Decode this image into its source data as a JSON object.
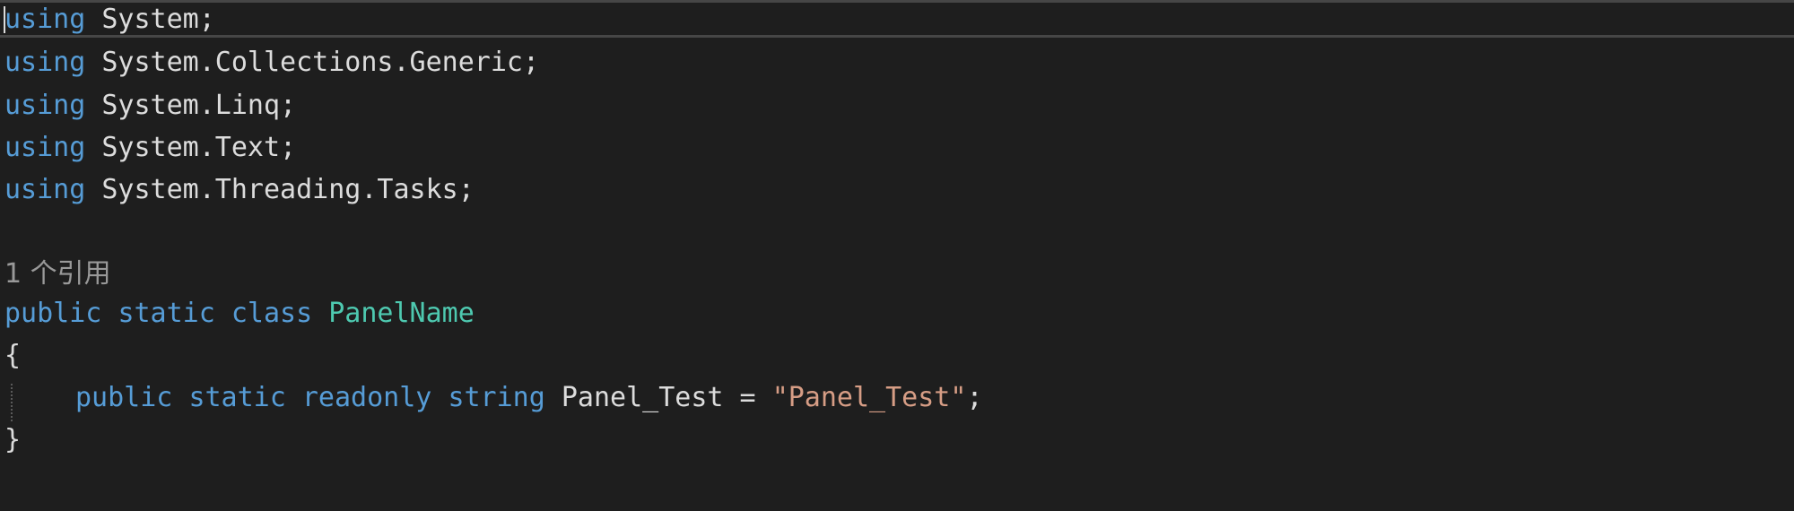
{
  "code": {
    "lines": [
      {
        "kw": "using",
        "text": " System;"
      },
      {
        "kw": "using",
        "text": " System.Collections.Generic;"
      },
      {
        "kw": "using",
        "text": " System.Linq;"
      },
      {
        "kw": "using",
        "text": " System.Text;"
      },
      {
        "kw": "using",
        "text": " System.Threading.Tasks;"
      }
    ],
    "codelens": "1 个引用",
    "class_decl": {
      "kw_public": "public",
      "kw_static": "static",
      "kw_class": "class",
      "name": "PanelName"
    },
    "open_brace": "{",
    "field": {
      "kw_public": "public",
      "kw_static": "static",
      "kw_readonly": "readonly",
      "kw_string": "string",
      "name": "Panel_Test",
      "op": " = ",
      "value": "\"Panel_Test\"",
      "end": ";"
    },
    "close_brace": "}"
  },
  "colors": {
    "background": "#1e1e1e",
    "keyword": "#569cd6",
    "type": "#4ec9b0",
    "string": "#d69d85",
    "text": "#dcdcdc"
  }
}
